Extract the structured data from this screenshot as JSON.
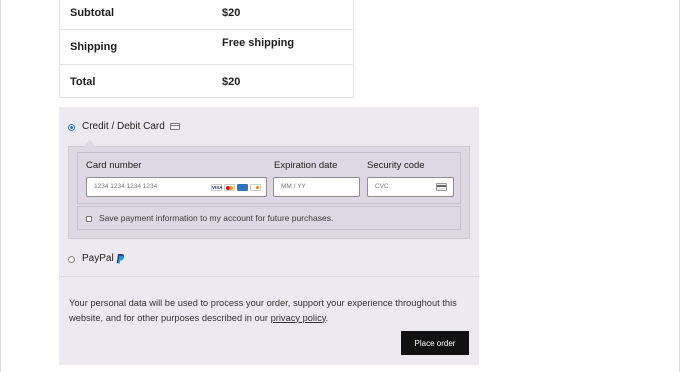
{
  "order_totals": {
    "rows": [
      {
        "label": "Subtotal",
        "value": "$20"
      },
      {
        "label": "Shipping",
        "value": "Free shipping"
      },
      {
        "label": "Total",
        "value": "$20"
      }
    ]
  },
  "payment": {
    "methods": [
      {
        "label": "Credit / Debit Card",
        "selected": true,
        "icon": "credit-card-icon"
      },
      {
        "label": "PayPal",
        "selected": false,
        "icon": "paypal-icon"
      }
    ],
    "card_form": {
      "card_number_label": "Card number",
      "card_number_placeholder": "1234 1234 1234 1234",
      "card_brands": [
        "visa-icon",
        "mastercard-icon",
        "amex-icon",
        "discover-icon"
      ],
      "expiration_label": "Expiration date",
      "expiration_placeholder": "MM / YY",
      "security_label": "Security code",
      "security_placeholder": "CVC",
      "save_info_label": "Save payment information to my account for future purchases."
    }
  },
  "privacy_notice": {
    "text_before_link": "Your personal data will be used to process your order, support your experience throughout this website, and for other purposes described in our ",
    "link_text": "privacy policy",
    "text_after_link": "."
  },
  "place_order_label": "Place order",
  "colors": {
    "accent": "#3a6fd8",
    "payment_background": "#ece9f0",
    "card_box_background": "#ddd8e3",
    "button_background": "#111111"
  }
}
